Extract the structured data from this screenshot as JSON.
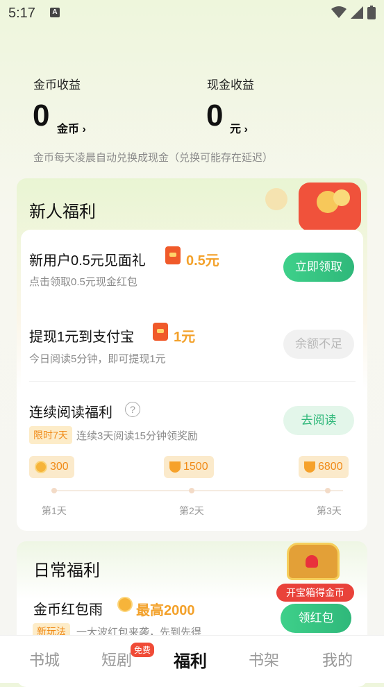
{
  "status_bar": {
    "time": "5:17"
  },
  "earnings": {
    "coin_title": "金币收益",
    "coin_value": "0",
    "coin_unit": "金币",
    "cash_title": "现金收益",
    "cash_value": "0",
    "cash_unit": "元",
    "note": "金币每天凌晨自动兑换成现金（兑换可能存在延迟）"
  },
  "newbie": {
    "title": "新人福利",
    "item1": {
      "title": "新用户0.5元见面礼",
      "amount": "0.5元",
      "sub": "点击领取0.5元现金红包",
      "button": "立即领取"
    },
    "item2": {
      "title": "提现1元到支付宝",
      "amount": "1元",
      "sub": "今日阅读5分钟，即可提现1元",
      "button": "余额不足"
    },
    "item3": {
      "title": "连续阅读福利",
      "help": "?",
      "badge": "限时7天",
      "sub": "连续3天阅读15分钟领奖励",
      "button": "去阅读",
      "rewards": [
        "300",
        "1500",
        "6800"
      ],
      "days": [
        "第1天",
        "第2天",
        "第3天"
      ]
    }
  },
  "daily": {
    "title": "日常福利",
    "chest_label": "开宝箱得金币",
    "item1": {
      "title": "金币红包雨",
      "amount": "最高2000",
      "tag": "新玩法",
      "sub": "一大波红包来袭，先到先得",
      "button": "领红包"
    }
  },
  "tabs": {
    "t1": "书城",
    "t2": "短剧",
    "t2_badge": "免费",
    "t3": "福利",
    "t4": "书架",
    "t5": "我的"
  }
}
